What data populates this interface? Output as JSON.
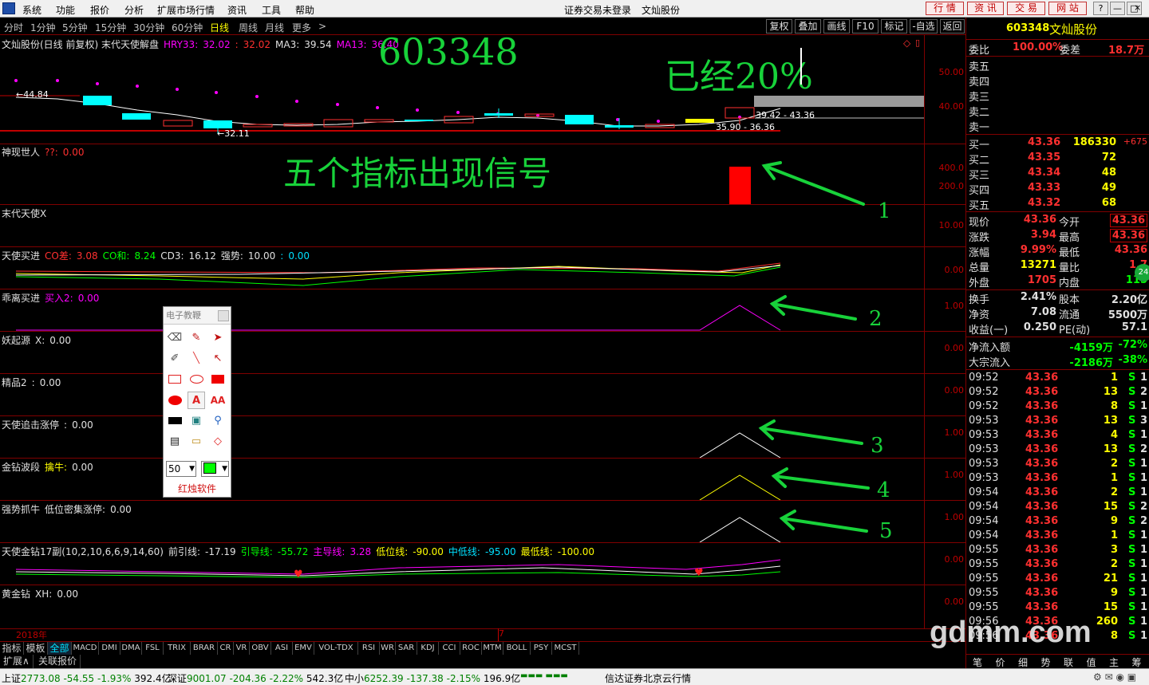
{
  "menubar": {
    "items": [
      "系统",
      "功能",
      "报价",
      "分析",
      "扩展市场行情",
      "资讯",
      "工具",
      "帮助"
    ],
    "status": "证券交易未登录",
    "stock_name": "文灿股份",
    "quick_buttons": [
      "行 情",
      "资 讯",
      "交 易",
      "网 站"
    ],
    "window_buttons": [
      "?",
      "—",
      "□",
      "×"
    ]
  },
  "periodbar": {
    "periods": [
      "分时",
      "1分钟",
      "5分钟",
      "15分钟",
      "30分钟",
      "60分钟",
      "日线",
      "周线",
      "月线",
      "更多",
      ">"
    ],
    "active": "日线",
    "tools": [
      "复权",
      "叠加",
      "画线",
      "F10",
      "标记",
      "-自选",
      "返回"
    ]
  },
  "main_panel": {
    "title": "文灿股份(日线 前复权) 末代天使解盘",
    "hry33_label": "HRY33:",
    "hry33_value": "32.02",
    "hry33_extra": "32.02",
    "ma3_label": "MA3:",
    "ma3_value": "39.54",
    "ma13_label": "MA13:",
    "ma13_value": "36.40",
    "axis": [
      "50.00",
      "40.00"
    ],
    "price_labels": {
      "high_left": "44.84",
      "low": "32.11",
      "range_top": "39.42 - 43.36",
      "range_bottom": "35.90 - 36.36"
    },
    "corner_icon": "diamond-icon"
  },
  "annotations": {
    "code": "603348",
    "already": "已经20%",
    "signals": "五个指标出现信号",
    "n1": "1",
    "n2": "2",
    "n3": "3",
    "n4": "4",
    "n5": "5"
  },
  "panels": {
    "shenxian": {
      "name": "神现世人",
      "label": "??:",
      "value": "0.00",
      "axis": [
        "400.0",
        "200.0"
      ]
    },
    "modai": {
      "name": "末代天使X",
      "axis": "10.00"
    },
    "tianshi": {
      "name": "天使买进",
      "co_diff_label": "CO差:",
      "co_diff": "3.08",
      "co_sum_label": "CO和:",
      "co_sum": "8.24",
      "cd3_label": "CD3:",
      "cd3": "16.12",
      "strong_label": "强势:",
      "strong": "10.00",
      "tail": "0.00",
      "axis": "0.00"
    },
    "guai": {
      "name": "乖离买进",
      "buy_label": "买入2:",
      "buy": "0.00",
      "axis": "1.00"
    },
    "yao": {
      "name": "妖起源",
      "x_label": "X:",
      "x": "0.00",
      "axis": "0.00"
    },
    "jing": {
      "name": "精品2",
      "value": "0.00",
      "axis": "0.00"
    },
    "zhui": {
      "name": "天使追击涨停",
      "value": "0.00",
      "axis": "1.00"
    },
    "jinzuan": {
      "name": "金钻波段",
      "label": "擒牛:",
      "value": "0.00",
      "axis": "1.00"
    },
    "qiang": {
      "name": "强势抓牛",
      "label": "低位密集涨停:",
      "value": "0.00",
      "axis": "1.00"
    },
    "tj17": {
      "name": "天使金钻17副(10,2,10,6,6,9,14,60)",
      "qy_label": "前引线:",
      "qy": "-17.19",
      "yd_label": "引导线:",
      "yd": "-55.72",
      "zd_label": "主导线:",
      "zd": "3.28",
      "dw_label": "低位线:",
      "dw": "-90.00",
      "zd2_label": "中低线:",
      "zd2": "-95.00",
      "zdx_label": "最低线:",
      "zdx": "-100.00",
      "axis": "0.00"
    },
    "huangjin": {
      "name": "黄金钻",
      "xh_label": "XH:",
      "xh": "0.00",
      "axis": "0.00"
    }
  },
  "x_axis": {
    "year": "2018年",
    "month": "7"
  },
  "tabs": [
    "指标",
    "模板",
    "全部",
    "MACD",
    "DMI",
    "DMA",
    "FSL",
    "TRIX",
    "BRAR",
    "CR",
    "VR",
    "OBV",
    "ASI",
    "EMV",
    "VOL-TDX",
    "RSI",
    "WR",
    "SAR",
    "KDJ",
    "CCI",
    "ROC",
    "MTM",
    "BOLL",
    "PSY",
    "MCST"
  ],
  "active_tab": "全部",
  "subtabs": [
    "扩展∧",
    "关联报价"
  ],
  "floatbox": {
    "title": "电子教鞭",
    "size_value": "50",
    "brand": "红烛软件"
  },
  "status": {
    "sh_label": "上证",
    "sh_val": "2773.08",
    "sh_chg": "-54.55",
    "sh_pct": "-1.93%",
    "sh_amt": "392.4亿",
    "sz_label": "深证",
    "sz_val": "9001.07",
    "sz_chg": "-204.36",
    "sz_pct": "-2.22%",
    "sz_amt": "542.3亿",
    "zx_label": "中小",
    "zx_val": "6252.39",
    "zx_chg": "-137.38",
    "zx_pct": "-2.15%",
    "zx_amt": "196.9亿",
    "broker": "信达证券北京云行情"
  },
  "quote": {
    "code": "603348",
    "name": "文灿股份",
    "weibi_label": "委比",
    "weibi": "100.00%",
    "weicha_label": "委差",
    "weicha": "18.7万",
    "sell_labels": [
      "卖五",
      "卖四",
      "卖三",
      "卖二",
      "卖一"
    ],
    "buys": [
      {
        "label": "买一",
        "price": "43.36",
        "vol": "186330",
        "chg": "+675"
      },
      {
        "label": "买二",
        "price": "43.35",
        "vol": "72",
        "chg": ""
      },
      {
        "label": "买三",
        "price": "43.34",
        "vol": "48",
        "chg": ""
      },
      {
        "label": "买四",
        "price": "43.33",
        "vol": "49",
        "chg": ""
      },
      {
        "label": "买五",
        "price": "43.32",
        "vol": "68",
        "chg": ""
      }
    ],
    "stats": [
      {
        "l1": "现价",
        "v1": "43.36",
        "l2": "今开",
        "v2": "43.36",
        "c1": "red",
        "c2": "red",
        "b2": true
      },
      {
        "l1": "涨跌",
        "v1": "3.94",
        "l2": "最高",
        "v2": "43.36",
        "c1": "red",
        "c2": "red",
        "b2": true
      },
      {
        "l1": "涨幅",
        "v1": "9.99%",
        "l2": "最低",
        "v2": "43.36",
        "c1": "red",
        "c2": "red",
        "b2": false
      },
      {
        "l1": "总量",
        "v1": "13271",
        "l2": "量比",
        "v2": "1.7",
        "c1": "yellow",
        "c2": "red",
        "b2": false
      },
      {
        "l1": "外盘",
        "v1": "1705",
        "l2": "内盘",
        "v2": "115",
        "c1": "red",
        "c2": "green",
        "b2": false
      }
    ],
    "stats2": [
      {
        "l1": "换手",
        "v1": "2.41%",
        "l2": "股本",
        "v2": "2.20亿"
      },
      {
        "l1": "净资",
        "v1": "7.08",
        "l2": "流通",
        "v2": "5500万"
      },
      {
        "l1": "收益(一)",
        "v1": "0.250",
        "l2": "PE(动)",
        "v2": "57.1"
      }
    ],
    "flows": [
      {
        "l": "净流入额",
        "v": "-4159万",
        "p": "-72%"
      },
      {
        "l": "大宗流入",
        "v": "-2186万",
        "p": "-38%"
      }
    ],
    "ticks": [
      {
        "t": "09:52",
        "p": "43.36",
        "v": "1",
        "s": "S",
        "n": "1"
      },
      {
        "t": "09:52",
        "p": "43.36",
        "v": "13",
        "s": "S",
        "n": "2"
      },
      {
        "t": "09:52",
        "p": "43.36",
        "v": "8",
        "s": "S",
        "n": "1"
      },
      {
        "t": "09:53",
        "p": "43.36",
        "v": "13",
        "s": "S",
        "n": "3"
      },
      {
        "t": "09:53",
        "p": "43.36",
        "v": "4",
        "s": "S",
        "n": "1"
      },
      {
        "t": "09:53",
        "p": "43.36",
        "v": "13",
        "s": "S",
        "n": "2"
      },
      {
        "t": "09:53",
        "p": "43.36",
        "v": "2",
        "s": "S",
        "n": "1"
      },
      {
        "t": "09:53",
        "p": "43.36",
        "v": "1",
        "s": "S",
        "n": "1"
      },
      {
        "t": "09:54",
        "p": "43.36",
        "v": "2",
        "s": "S",
        "n": "1"
      },
      {
        "t": "09:54",
        "p": "43.36",
        "v": "15",
        "s": "S",
        "n": "2"
      },
      {
        "t": "09:54",
        "p": "43.36",
        "v": "9",
        "s": "S",
        "n": "2"
      },
      {
        "t": "09:54",
        "p": "43.36",
        "v": "1",
        "s": "S",
        "n": "1"
      },
      {
        "t": "09:55",
        "p": "43.36",
        "v": "3",
        "s": "S",
        "n": "1"
      },
      {
        "t": "09:55",
        "p": "43.36",
        "v": "2",
        "s": "S",
        "n": "1"
      },
      {
        "t": "09:55",
        "p": "43.36",
        "v": "21",
        "s": "S",
        "n": "1"
      },
      {
        "t": "09:55",
        "p": "43.36",
        "v": "9",
        "s": "S",
        "n": "1"
      },
      {
        "t": "09:55",
        "p": "43.36",
        "v": "15",
        "s": "S",
        "n": "1"
      },
      {
        "t": "09:56",
        "p": "43.36",
        "v": "260",
        "s": "S",
        "n": "1"
      },
      {
        "t": "09:56",
        "p": "43.36",
        "v": "8",
        "s": "S",
        "n": "1"
      }
    ],
    "side_badge": "24",
    "bottom_tabs": [
      "笔",
      "价",
      "细",
      "势",
      "联",
      "值",
      "主",
      "筹"
    ]
  },
  "watermark": "gdmm.com",
  "colors": {
    "axis_red": "#800000",
    "annot_green": "#18d23a",
    "up_red": "#ff3030",
    "down_cyan": "#00ffff"
  }
}
